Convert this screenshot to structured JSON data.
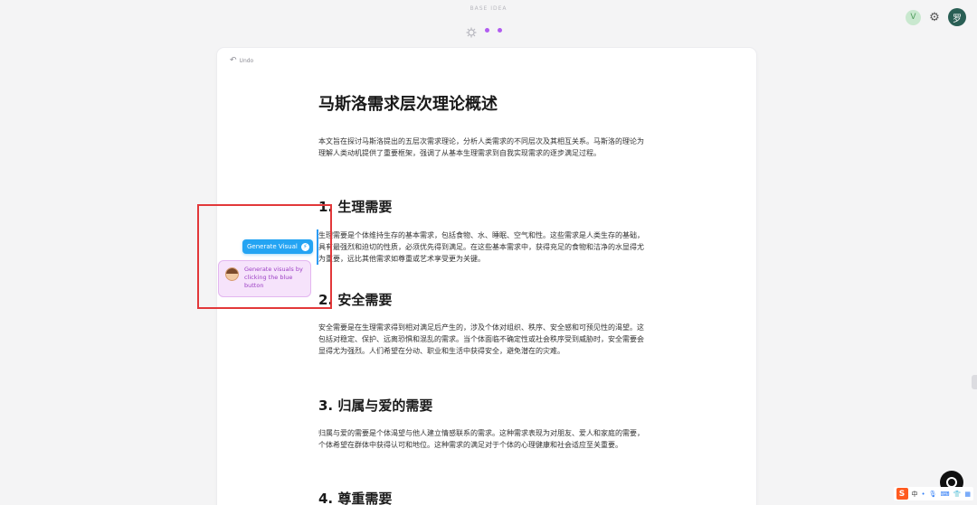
{
  "topbar": {
    "label": "BASE IDEA",
    "settings_icon": "gear-icon",
    "avatar_v_letter": "V",
    "avatar_user_letter": "罗"
  },
  "editor": {
    "undo_label": "Undo",
    "title": "马斯洛需求层次理论概述",
    "intro": "本文旨在探讨马斯洛提出的五层次需求理论，分析人类需求的不同层次及其相互关系。马斯洛的理论为理解人类动机提供了重要框架，强调了从基本生理需求到自我实现需求的逐步满足过程。",
    "sections": [
      {
        "heading": "1. 生理需要",
        "body": "生理需要是个体维持生存的基本需求，包括食物、水、睡眠、空气和性。这些需求是人类生存的基础，具有最强烈和迫切的性质，必须优先得到满足。在这些基本需求中，获得充足的食物和洁净的水显得尤为重要，远比其他需求如尊重或艺术享受更为关键。"
      },
      {
        "heading": "2. 安全需要",
        "body": "安全需要是在生理需求得到相对满足后产生的，涉及个体对组织、秩序、安全感和可预见性的渴望。这包括对稳定、保护、远离恐惧和混乱的需求。当个体面临不确定性或社会秩序受到威胁时，安全需要会显得尤为强烈。人们希望在分动、职业和生活中获得安全，避免潜在的灾难。"
      },
      {
        "heading": "3. 归属与爱的需要",
        "body": "归属与爱的需要是个体渴望与他人建立情感联系的需求。这种需求表现为对朋友、爱人和家庭的需要，个体希望在群体中获得认可和地位。这种需求的满足对于个体的心理健康和社会适应至关重要。"
      },
      {
        "heading": "4. 尊重需要",
        "body": ""
      }
    ]
  },
  "generate_visual": {
    "button_label": "Generate Visual",
    "icon": "bolt-icon"
  },
  "tooltip": {
    "text": "Generate visuals by clicking the blue button"
  },
  "ime": {
    "logo": "S",
    "mode": "中"
  },
  "colors": {
    "accent_blue": "#24a4f3",
    "tooltip_purple": "#9b3fc4",
    "highlight_red": "#e2383a"
  }
}
